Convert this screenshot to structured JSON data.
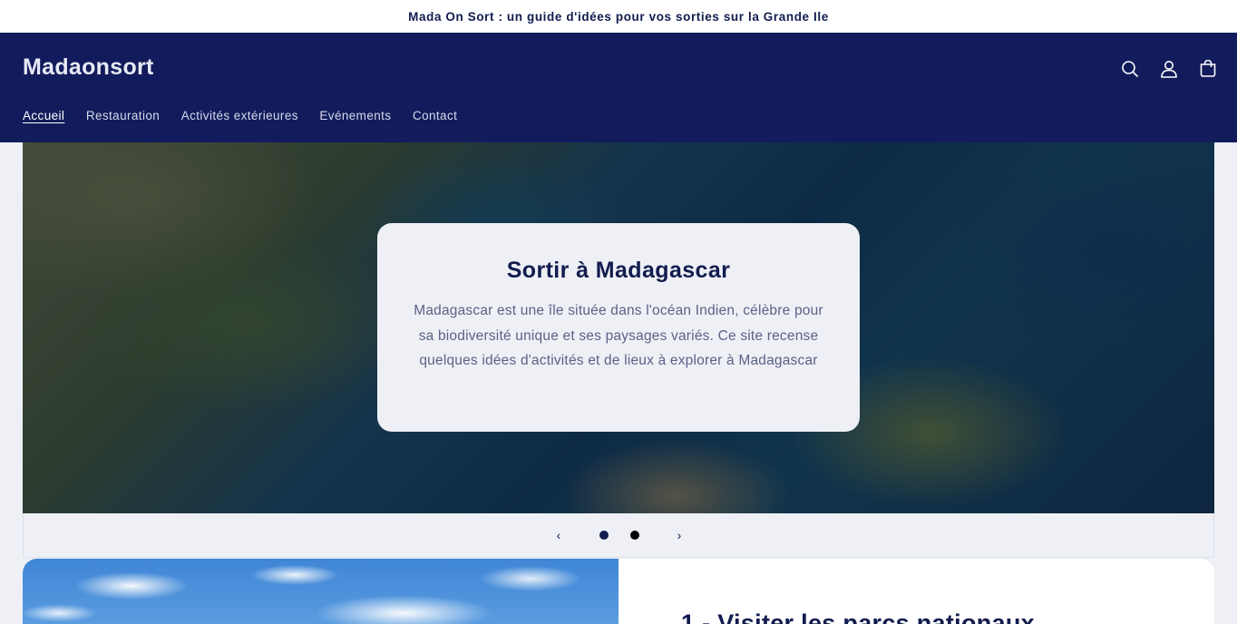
{
  "announcement": "Mada On Sort : un guide d'idées pour vos sorties sur la Grande Ile",
  "header": {
    "logo": "Madaonsort",
    "nav": [
      {
        "label": "Accueil",
        "active": true
      },
      {
        "label": "Restauration",
        "active": false
      },
      {
        "label": "Activités extérieures",
        "active": false
      },
      {
        "label": "Evénements",
        "active": false
      },
      {
        "label": "Contact",
        "active": false
      }
    ],
    "icons": [
      "search-icon",
      "account-icon",
      "cart-icon"
    ]
  },
  "hero": {
    "title": "Sortir à Madagascar",
    "text": "Madagascar est une île située dans l'océan Indien, célèbre pour sa biodiversité unique et ses paysages variés. Ce site recense quelques idées d'activités et de lieux à explorer à Madagascar",
    "prev_symbol": "‹",
    "next_symbol": "›",
    "slides_count": 2
  },
  "feature": {
    "title": "1 - Visiter les parcs nationaux"
  },
  "colors": {
    "primary": "#121c5c",
    "text": "#121c4e",
    "background": "#eef0f6"
  }
}
